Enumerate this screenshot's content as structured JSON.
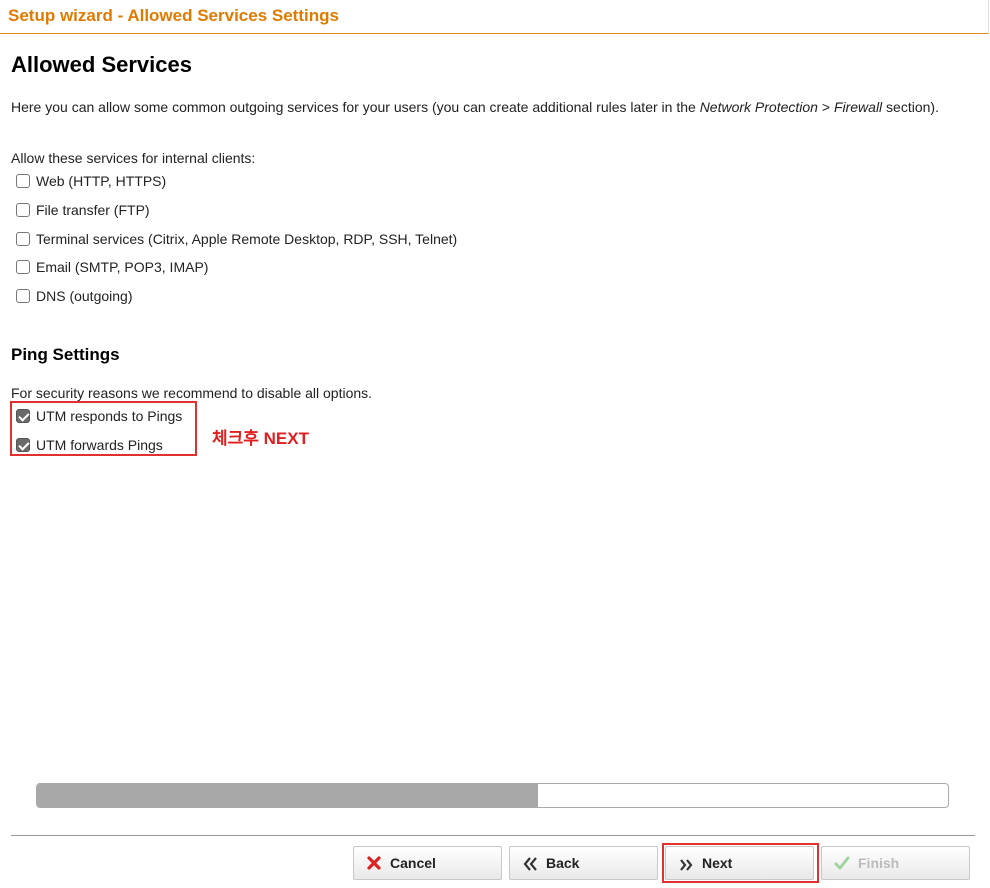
{
  "window": {
    "title": "Setup wizard - Allowed Services Settings"
  },
  "allowed_services": {
    "heading": "Allowed Services",
    "intro_before": "Here you can allow some common outgoing services for your users (you can create additional rules later in the ",
    "intro_link_1": "Network Protection",
    "intro_separator": " > ",
    "intro_link_2": "Firewall",
    "intro_after": " section).",
    "list_label": "Allow these services for internal clients:",
    "services": [
      {
        "label": "Web (HTTP, HTTPS)",
        "checked": false
      },
      {
        "label": "File transfer (FTP)",
        "checked": false
      },
      {
        "label": "Terminal services (Citrix, Apple Remote Desktop, RDP, SSH, Telnet)",
        "checked": false
      },
      {
        "label": "Email (SMTP, POP3, IMAP)",
        "checked": false
      },
      {
        "label": "DNS (outgoing)",
        "checked": false
      }
    ]
  },
  "ping_settings": {
    "heading": "Ping Settings",
    "note": "For security reasons we recommend to disable all options.",
    "options": [
      {
        "label": "UTM responds to Pings",
        "checked": true
      },
      {
        "label": "UTM forwards Pings",
        "checked": true
      }
    ]
  },
  "annotation": {
    "text": "체크후 NEXT",
    "color": "#e02020"
  },
  "progress": {
    "fraction": 0.55
  },
  "buttons": {
    "cancel": "Cancel",
    "back": "Back",
    "next": "Next",
    "finish": "Finish"
  },
  "colors": {
    "accent": "#e07b00",
    "highlight": "#e03030",
    "progress_fill": "#a8a8a8"
  }
}
